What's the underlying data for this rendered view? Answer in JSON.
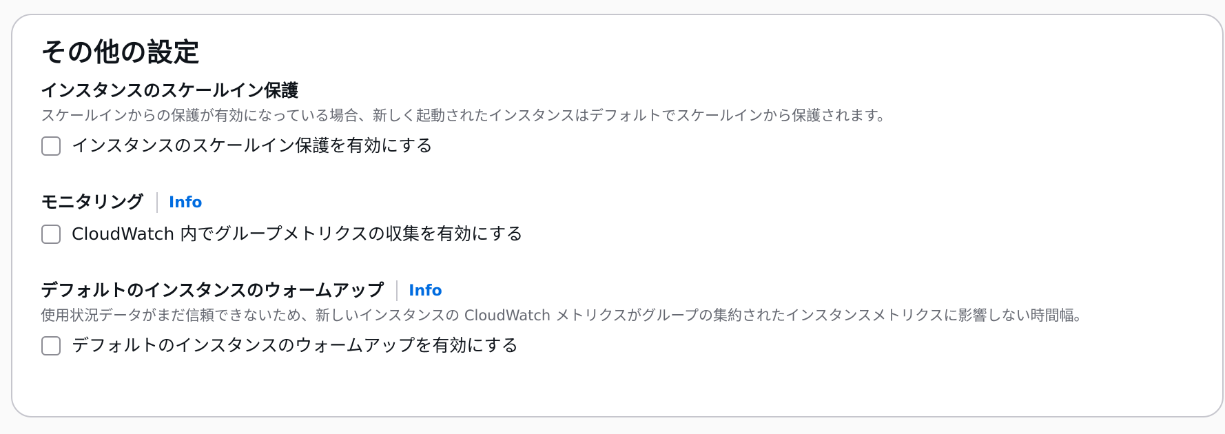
{
  "panel": {
    "title": "その他の設定"
  },
  "scale_in": {
    "label": "インスタンスのスケールイン保護",
    "description": "スケールインからの保護が有効になっている場合、新しく起動されたインスタンスはデフォルトでスケールインから保護されます。",
    "checkbox_label": "インスタンスのスケールイン保護を有効にする",
    "checked": false
  },
  "monitoring": {
    "label": "モニタリング",
    "info": "Info",
    "checkbox_label": "CloudWatch 内でグループメトリクスの収集を有効にする",
    "checked": false
  },
  "warmup": {
    "label": "デフォルトのインスタンスのウォームアップ",
    "info": "Info",
    "description": "使用状況データがまだ信頼できないため、新しいインスタンスの CloudWatch メトリクスがグループの集約されたインスタンスメトリクスに影響しない時間幅。",
    "checkbox_label": "デフォルトのインスタンスのウォームアップを有効にする",
    "checked": false
  },
  "colors": {
    "link": "#006ce0",
    "description": "#656871",
    "border": "#c6c6cd"
  }
}
